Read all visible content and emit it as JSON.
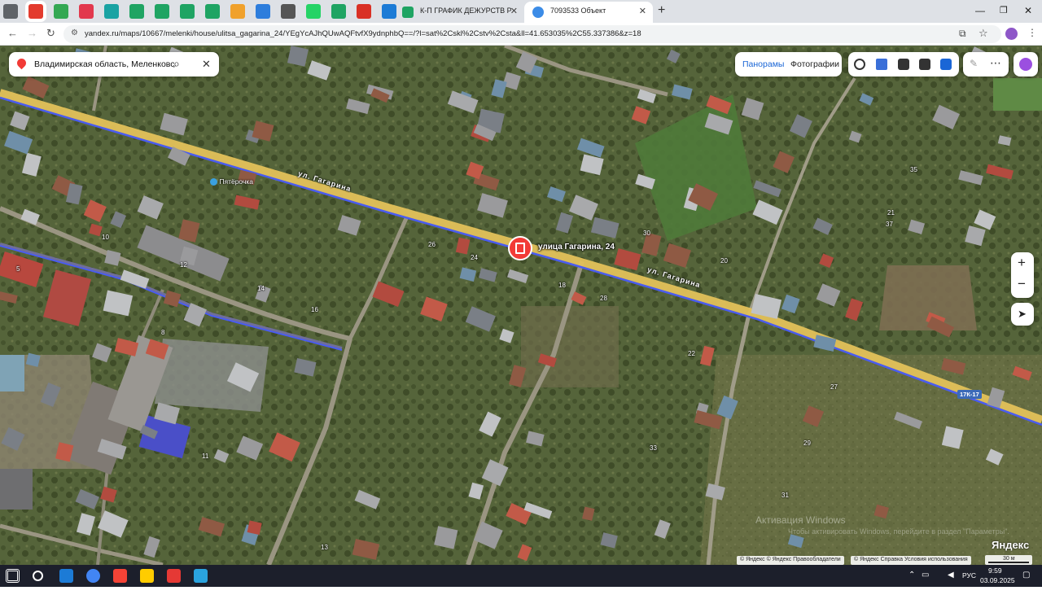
{
  "browser": {
    "pinned_icons": [
      {
        "name": "tab-list-icon",
        "color": "#5f6368"
      },
      {
        "name": "yandex-maps-pin-icon",
        "color": "#e33b2e"
      },
      {
        "name": "google-maps-icon",
        "color": "#34a853"
      },
      {
        "name": "record-icon",
        "color": "#e2384d"
      },
      {
        "name": "chat-icon",
        "color": "#1aa3a3"
      },
      {
        "name": "sheets-icon",
        "color": "#1fa463"
      },
      {
        "name": "sheets-icon",
        "color": "#1fa463"
      },
      {
        "name": "sheets-icon",
        "color": "#1fa463"
      },
      {
        "name": "sheets-icon",
        "color": "#1fa463"
      },
      {
        "name": "mail-icon",
        "color": "#f0a12c"
      },
      {
        "name": "camera-icon",
        "color": "#2d7ddc"
      },
      {
        "name": "grid-icon",
        "color": "#555555"
      },
      {
        "name": "whatsapp-icon",
        "color": "#25d366"
      },
      {
        "name": "sheets-icon",
        "color": "#1fa463"
      },
      {
        "name": "avito-icon",
        "color": "#d93025"
      },
      {
        "name": "edge-icon",
        "color": "#1c7bd6"
      }
    ],
    "tabs": [
      {
        "title": "К-П ГРАФИК ДЕЖУРСТВ РИЭЛ",
        "favicon_color": "#1fa463",
        "active": false
      },
      {
        "title": "7093533 Объект",
        "favicon_color": "#3c8ce7",
        "active": true
      }
    ],
    "new_tab_label": "+",
    "url": "yandex.ru/maps/10667/melenki/house/ulitsa_gagarina_24/YEgYcAJhQUwAQFtvfX9ydnphbQ==/?l=sat%2Cskl%2Cstv%2Csta&ll=41.653035%2C55.337386&z=18"
  },
  "map": {
    "search_text": "Владимирская область, Меленковск",
    "layers": {
      "panoramas": "Панорамы",
      "photos": "Фотографии"
    },
    "zoom_in": "+",
    "zoom_out": "−",
    "selected_address": "улица Гагарина, 24",
    "street_labels": [
      "ул. Гагарина",
      "ул. Гагарина"
    ],
    "road_badge": "17К-17",
    "poi_label": "Пятёрочка",
    "house_numbers": [
      "24",
      "28",
      "26",
      "18",
      "20",
      "22",
      "29",
      "30",
      "33",
      "10",
      "12",
      "14",
      "16",
      "8",
      "5",
      "13",
      "11",
      "27",
      "31",
      "35",
      "37",
      "21"
    ],
    "watermark": "Активация Windows",
    "watermark_sub": "Чтобы активировать Windows, перейдите в раздел \"Параметры\".",
    "brand": "Яндекс",
    "copyright": [
      "© Яндекс © Яндекс  Правообладатели",
      "© Яндекс  Справка  Условия использования"
    ],
    "scale": "30 м"
  },
  "taskbar": {
    "apps": [
      {
        "name": "windows-start-icon",
        "color": "#ffffff"
      },
      {
        "name": "search-icon",
        "color": "#ffffff"
      },
      {
        "name": "edge-icon",
        "color": "#1c7bd6"
      },
      {
        "name": "chrome-icon",
        "color": "#4285f4"
      },
      {
        "name": "yandex-icon",
        "color": "#f44336"
      },
      {
        "name": "yandex-browser-icon",
        "color": "#ffcc00"
      },
      {
        "name": "wps-icon",
        "color": "#e53935"
      },
      {
        "name": "telegram-icon",
        "color": "#2aa3de"
      }
    ],
    "language": "РУС",
    "time": "9:59",
    "date": "03.09.2025"
  }
}
